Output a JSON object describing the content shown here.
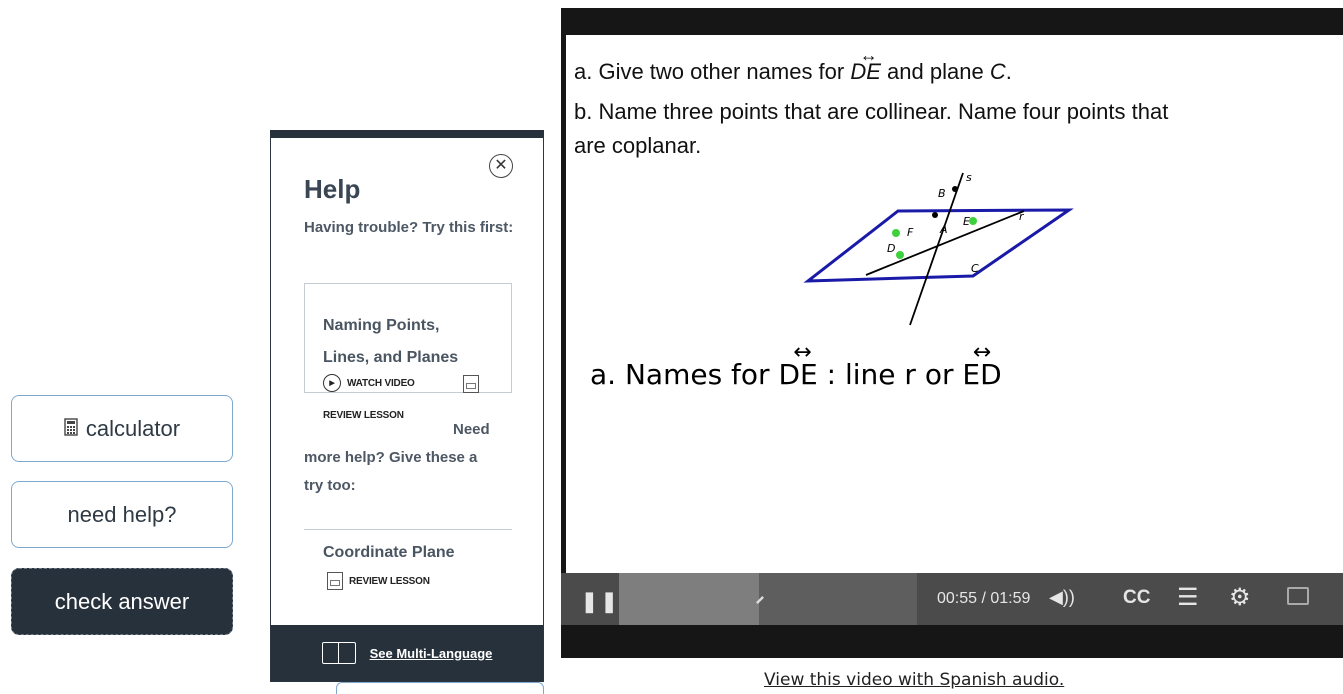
{
  "actions": {
    "calculator_label": "calculator",
    "need_help_label": "need help?",
    "check_answer_label": "check answer"
  },
  "help": {
    "title": "Help",
    "intro": "Having trouble? Try this first:",
    "lesson_card": {
      "title_line1": "Naming Points,",
      "title_line2": "Lines, and Planes",
      "watch_video": "WATCH VIDEO",
      "review_lesson": "REVIEW LESSON"
    },
    "more_help_line1": "Need",
    "more_help_line2": "more help? Give these a",
    "more_help_line3": "try too:",
    "extra_lesson": {
      "title": "Coordinate Plane",
      "review_lesson": "REVIEW LESSON"
    },
    "footer_link": "See Multi-Language"
  },
  "video": {
    "question_a_prefix": "a. Give two other names for",
    "question_a_line": "DE",
    "question_a_suffix": "and plane",
    "question_a_plane": "C",
    "question_b_line1": "b. Name three points that are collinear. Name four points that",
    "question_b_line2": "are coplanar.",
    "diagram_points": [
      "s",
      "B",
      "F",
      "E",
      "r",
      "D",
      "A",
      "C"
    ],
    "handwritten_prefix": "a. Names for",
    "handwritten_de": "DE",
    "handwritten_colon": ":",
    "handwritten_line_r": "line r",
    "handwritten_or": "or",
    "handwritten_ed": "ED",
    "time_display": "00:55 / 01:59",
    "cc_label": "CC",
    "progress_fraction": 0.46
  },
  "spanish_audio_link": "View this video with Spanish audio.",
  "colors": {
    "dark_navy": "#27313c",
    "button_border": "#7fa8cf",
    "plane_blue": "#1a1aa8",
    "point_green": "#3dd13d"
  }
}
